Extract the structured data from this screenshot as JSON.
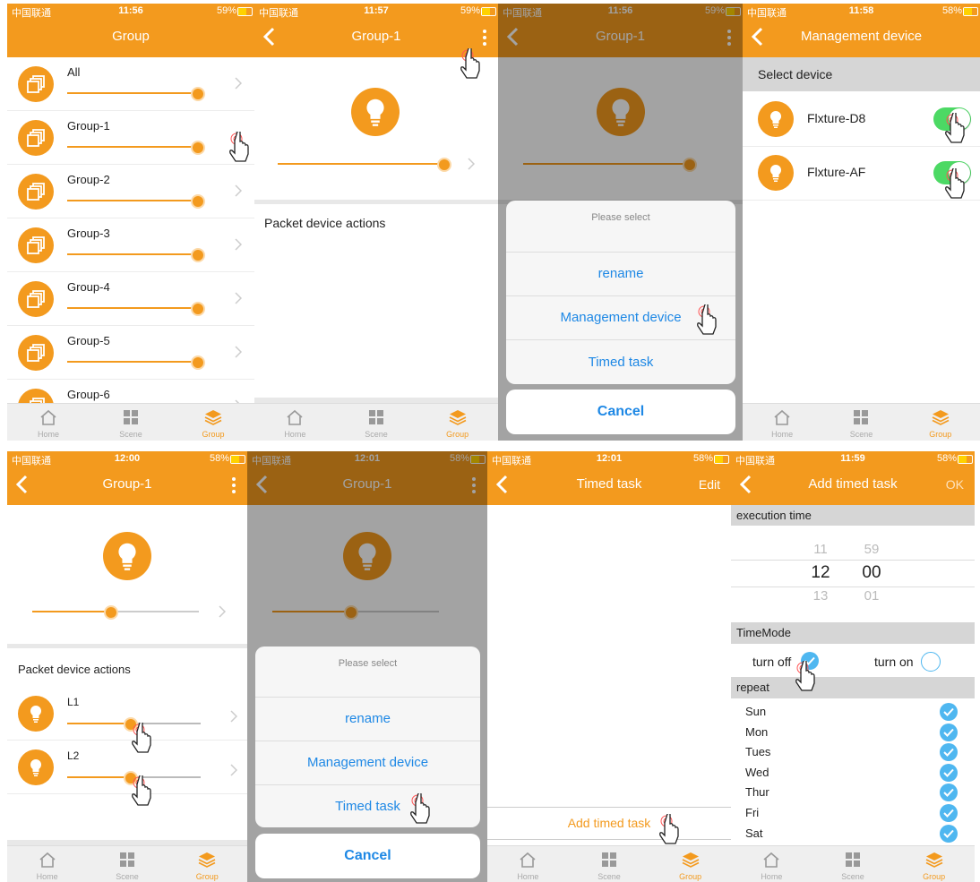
{
  "status": {
    "carrier": "中国联通",
    "times": [
      "11:56",
      "11:57",
      "11:56",
      "11:58",
      "12:00",
      "12:01",
      "12:01",
      "11:59"
    ],
    "battery": [
      "59%",
      "59%",
      "59%",
      "58%",
      "58%",
      "58%",
      "58%",
      "58%"
    ]
  },
  "tabs": [
    "Home",
    "Scene",
    "Group"
  ],
  "colors": {
    "accent": "#F39A1E",
    "link": "#1E88E5",
    "check": "#4FB7F0",
    "toggle": "#4CD964"
  },
  "icons": [
    "signal-icon",
    "bluetooth-icon",
    "battery-icon",
    "back-icon",
    "more-vertical-icon",
    "chevron-right-icon",
    "group-icon",
    "bulb-icon",
    "hand-pointer-icon",
    "home-icon",
    "scene-icon",
    "layers-icon",
    "check-icon"
  ],
  "panel1": {
    "title": "Group",
    "groups": [
      {
        "name": "All",
        "level": 1.0
      },
      {
        "name": "Group-1",
        "level": 1.0
      },
      {
        "name": "Group-2",
        "level": 1.0
      },
      {
        "name": "Group-3",
        "level": 1.0
      },
      {
        "name": "Group-4",
        "level": 1.0
      },
      {
        "name": "Group-5",
        "level": 1.0
      },
      {
        "name": "Group-6",
        "level": 1.0
      }
    ]
  },
  "panel2": {
    "title": "Group-1",
    "section": "Packet device actions",
    "level": 1.0
  },
  "panel3": {
    "title": "Group-1",
    "sheet": {
      "header": "Please select",
      "options": [
        "rename",
        "Management device",
        "Timed task"
      ],
      "cancel": "Cancel"
    }
  },
  "panel4": {
    "title": "Management device",
    "section": "Select device",
    "devices": [
      {
        "name": "Flxture-D8",
        "on": true
      },
      {
        "name": "Flxture-AF",
        "on": true
      }
    ]
  },
  "panel5": {
    "title": "Group-1",
    "section": "Packet device actions",
    "group_level": 0.5,
    "devices": [
      {
        "name": "L1",
        "level": 0.5
      },
      {
        "name": "L2",
        "level": 0.5
      }
    ]
  },
  "panel6": {
    "title": "Group-1",
    "sheet": {
      "header": "Please select",
      "options": [
        "rename",
        "Management device",
        "Timed task"
      ],
      "cancel": "Cancel"
    }
  },
  "panel7": {
    "title": "Timed task",
    "right": "Edit",
    "add": "Add timed task"
  },
  "panel8": {
    "title": "Add timed task",
    "right": "OK",
    "exec_label": "execution time",
    "hours": [
      "11",
      "12",
      "13"
    ],
    "minutes": [
      "59",
      "00",
      "01"
    ],
    "mode_label": "TimeMode",
    "off_label": "turn off",
    "on_label": "turn on",
    "mode": "turn off",
    "repeat_label": "repeat",
    "days": [
      "Sun",
      "Mon",
      "Tues",
      "Wed",
      "Thur",
      "Fri",
      "Sat"
    ]
  }
}
